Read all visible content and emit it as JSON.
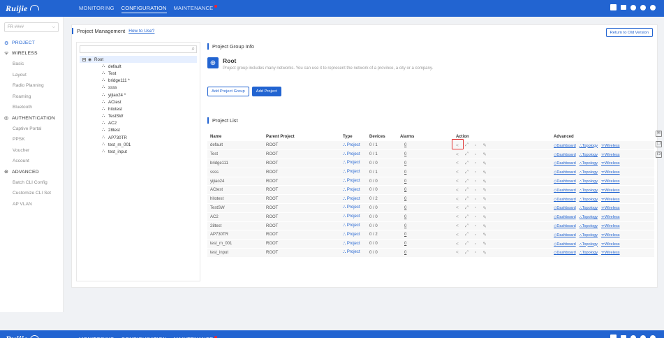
{
  "topbar": {
    "brand": "Ruijie",
    "nav": [
      {
        "label": "MONITORING",
        "active": false
      },
      {
        "label": "CONFIGURATION",
        "active": true
      },
      {
        "label": "MAINTENANCE",
        "active": false
      }
    ]
  },
  "sidebar": {
    "tenant": "FR ####",
    "sections": [
      {
        "label": "PROJECT",
        "icon": "project-icon",
        "items": []
      },
      {
        "label": "WIRELESS",
        "icon": "wifi-icon",
        "items": [
          "Basic",
          "Layout",
          "Radio Planning",
          "Roaming",
          "Bluetooth"
        ]
      },
      {
        "label": "AUTHENTICATION",
        "icon": "auth-icon",
        "items": [
          "Captive Portal",
          "PPSK",
          "Voucher",
          "Account"
        ]
      },
      {
        "label": "ADVANCED",
        "icon": "advanced-icon",
        "items": [
          "Batch CLI Config",
          "Customize CLI Set",
          "AP VLAN"
        ]
      }
    ]
  },
  "header": {
    "title": "Project Management",
    "help_link": "How to Use?",
    "return_button": "Return to Old Version"
  },
  "tree": {
    "search_placeholder": "",
    "root": "Root",
    "children": [
      "default",
      "Test",
      "bridge111 *",
      "ssss",
      "yijiao24 *",
      "ACtest",
      "hitotest",
      "TestSW",
      "AC2",
      "28test",
      "AP730TR",
      "test_m_001",
      "test_input"
    ]
  },
  "group_info": {
    "section_title": "Project Group Info",
    "name": "Root",
    "description": "Project group includes many networks. You can use it to represent the network of a province, a city or a company.",
    "add_group_button": "Add Project Group",
    "add_project_button": "Add Project"
  },
  "project_list": {
    "section_title": "Project List",
    "columns": [
      "Name",
      "Parent Project",
      "Type",
      "Devices",
      "Alarms",
      "Action",
      "Advanced"
    ],
    "type_label": "Project",
    "advanced_links": [
      "Dashboard",
      "Topology",
      "Wireless"
    ],
    "rows": [
      {
        "name": "default",
        "parent": "ROOT",
        "devices": "0 / 1",
        "alarms": "0"
      },
      {
        "name": "Test",
        "parent": "ROOT",
        "devices": "0 / 1",
        "alarms": "0"
      },
      {
        "name": "bridge111",
        "parent": "ROOT",
        "devices": "0 / 0",
        "alarms": "0"
      },
      {
        "name": "ssss",
        "parent": "ROOT",
        "devices": "0 / 1",
        "alarms": "0"
      },
      {
        "name": "yijiao24",
        "parent": "ROOT",
        "devices": "0 / 0",
        "alarms": "0"
      },
      {
        "name": "ACtest",
        "parent": "ROOT",
        "devices": "0 / 0",
        "alarms": "0"
      },
      {
        "name": "hitotest",
        "parent": "ROOT",
        "devices": "0 / 2",
        "alarms": "0"
      },
      {
        "name": "TestSW",
        "parent": "ROOT",
        "devices": "0 / 0",
        "alarms": "0"
      },
      {
        "name": "AC2",
        "parent": "ROOT",
        "devices": "0 / 0",
        "alarms": "0"
      },
      {
        "name": "28test",
        "parent": "ROOT",
        "devices": "0 / 0",
        "alarms": "0"
      },
      {
        "name": "AP730TR",
        "parent": "ROOT",
        "devices": "0 / 2",
        "alarms": "0"
      },
      {
        "name": "test_m_001",
        "parent": "ROOT",
        "devices": "0 / 0",
        "alarms": "0"
      },
      {
        "name": "test_input",
        "parent": "ROOT",
        "devices": "0 / 0",
        "alarms": "0"
      }
    ]
  },
  "colors": {
    "primary": "#2264d1",
    "highlight": "#e02b2b",
    "green": "#389e0d"
  }
}
